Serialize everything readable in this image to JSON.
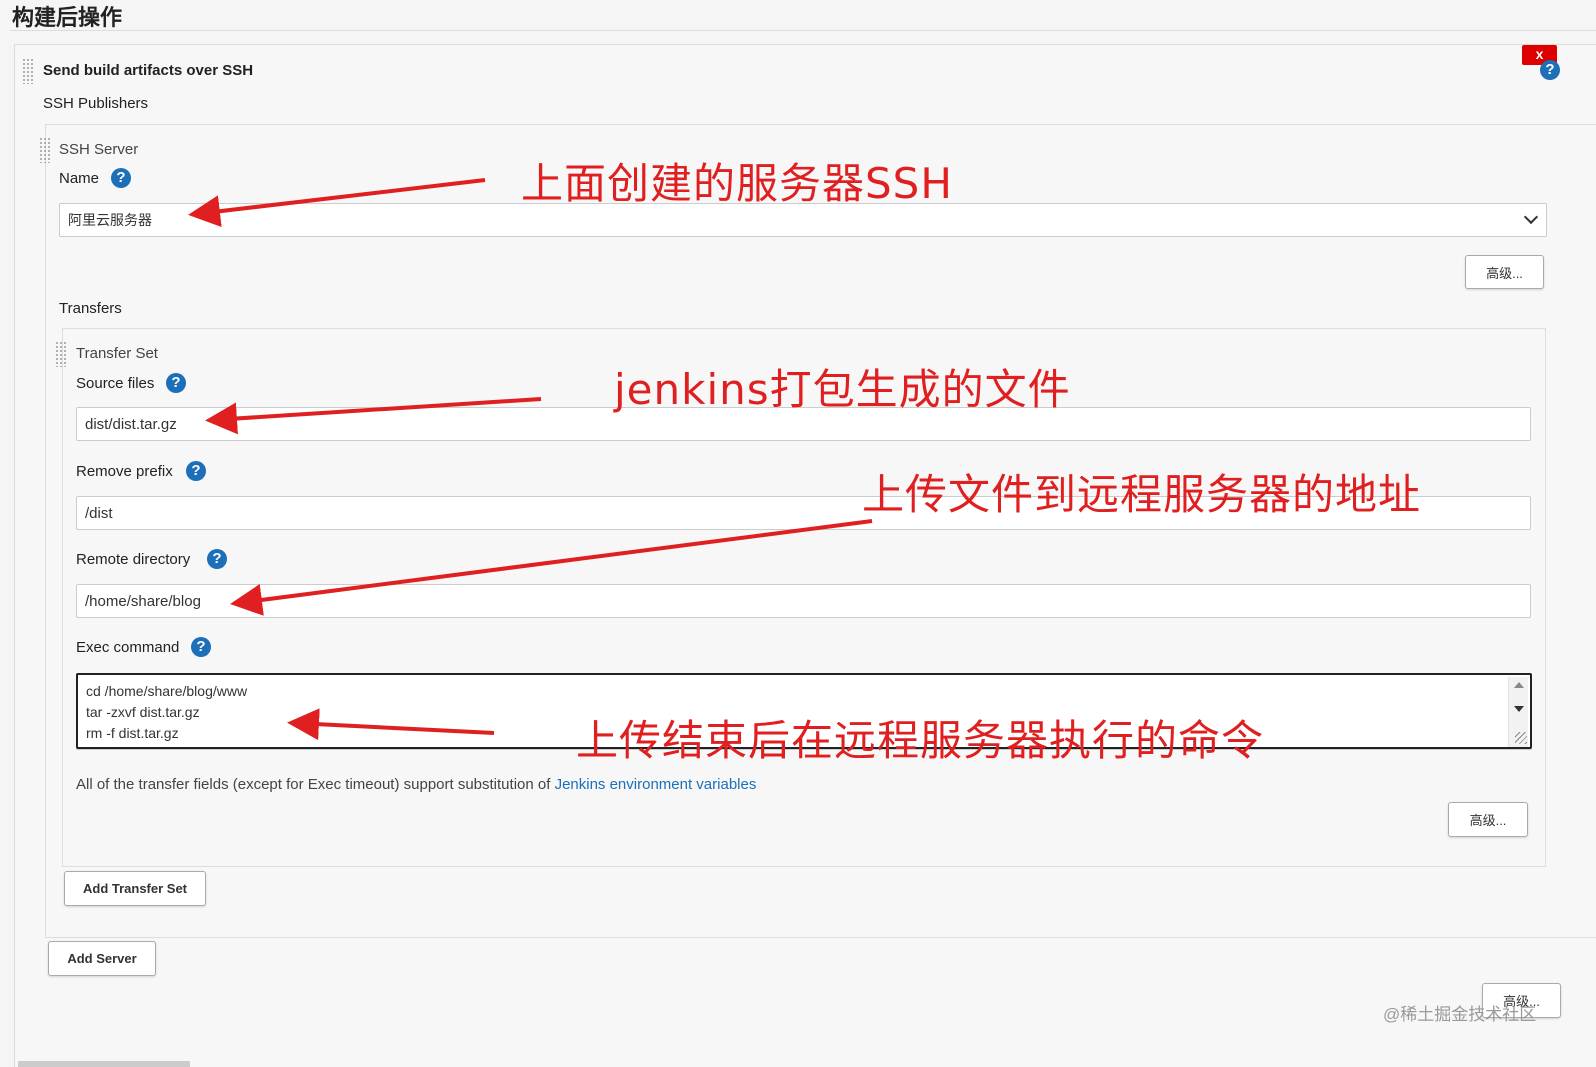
{
  "section": {
    "title": "构建后操作"
  },
  "plugin": {
    "title": "Send build artifacts over SSH",
    "delete_label": "x",
    "help": "?",
    "publishers_label": "SSH Publishers"
  },
  "server": {
    "section_label": "SSH Server",
    "name_label": "Name",
    "name_value": "阿里云服务器",
    "advanced_label": "高级...",
    "transfers_label": "Transfers"
  },
  "transfer": {
    "section_label": "Transfer Set",
    "source_files_label": "Source files",
    "source_files_value": "dist/dist.tar.gz",
    "remove_prefix_label": "Remove prefix",
    "remove_prefix_value": "/dist",
    "remote_directory_label": "Remote directory",
    "remote_directory_value": "/home/share/blog",
    "exec_command_label": "Exec command",
    "exec_command_lines": [
      "cd  /home/share/blog/www",
      "tar -zxvf dist.tar.gz",
      "rm -f  dist.tar.gz"
    ],
    "note_text": "All of the transfer fields (except for Exec timeout) support substitution of ",
    "note_link": "Jenkins environment variables",
    "advanced_label": "高级..."
  },
  "buttons": {
    "add_transfer_set": "Add Transfer Set",
    "add_server": "Add Server",
    "advanced_bottom": "高级..."
  },
  "annotations": {
    "server": "上面创建的服务器SSH",
    "source": "jenkins打包生成的文件",
    "remote": "上传文件到远程服务器的地址",
    "exec": "上传结束后在远程服务器执行的命令",
    "color": "#e02020"
  },
  "watermark": "@稀土掘金技术社区",
  "colors": {
    "help": "#1d6fb8",
    "delete": "#dd0000",
    "link": "#1d6fb8"
  }
}
